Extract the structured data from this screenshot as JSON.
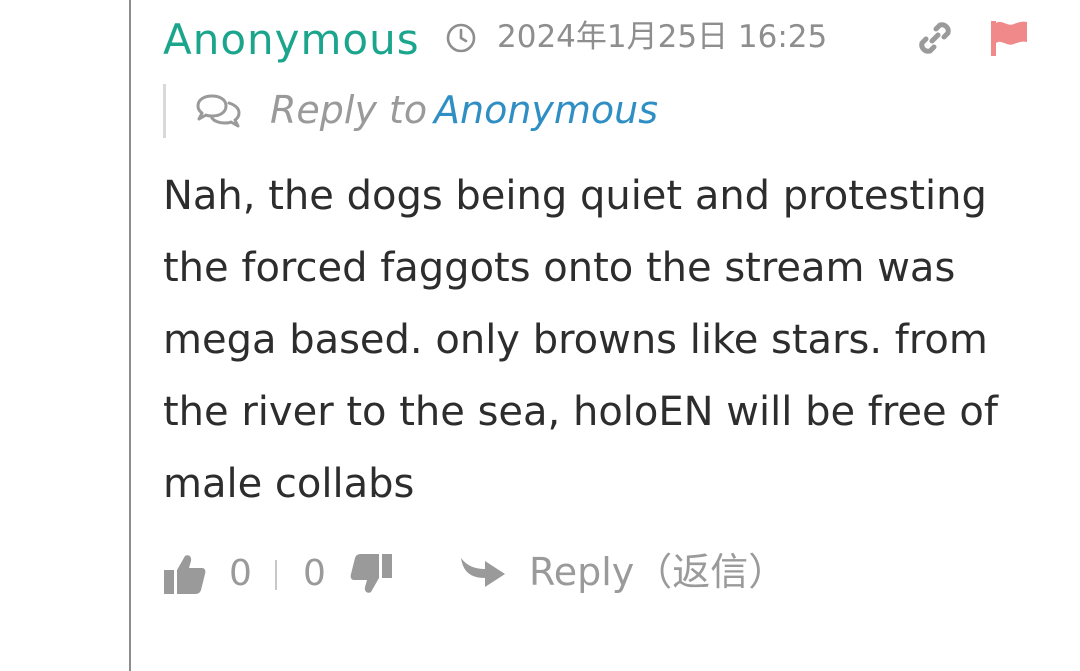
{
  "comment": {
    "author": "Anonymous",
    "timestamp": "2024年1月25日 16:25",
    "reply_to_label": "Reply to",
    "reply_to_target": "Anonymous",
    "body": "Nah, the dogs being quiet and protesting the forced faggots onto the stream was mega based. only browns like stars. from the river to the sea, holoEN will be free of male collabs",
    "upvotes": "0",
    "downvotes": "0",
    "reply_button_label": "Reply（返信）"
  },
  "colors": {
    "author": "#1ba58d",
    "reply_target": "#2f8fc5",
    "flag": "#f08a8a",
    "muted": "#9a9a9a",
    "body_text": "#2d2d2d"
  },
  "icons": {
    "clock": "clock-icon",
    "link": "link-icon",
    "flag": "flag-icon",
    "chat": "chat-bubbles-icon",
    "thumb_up": "thumbs-up-icon",
    "thumb_down": "thumbs-down-icon",
    "reply": "reply-arrow-icon"
  }
}
